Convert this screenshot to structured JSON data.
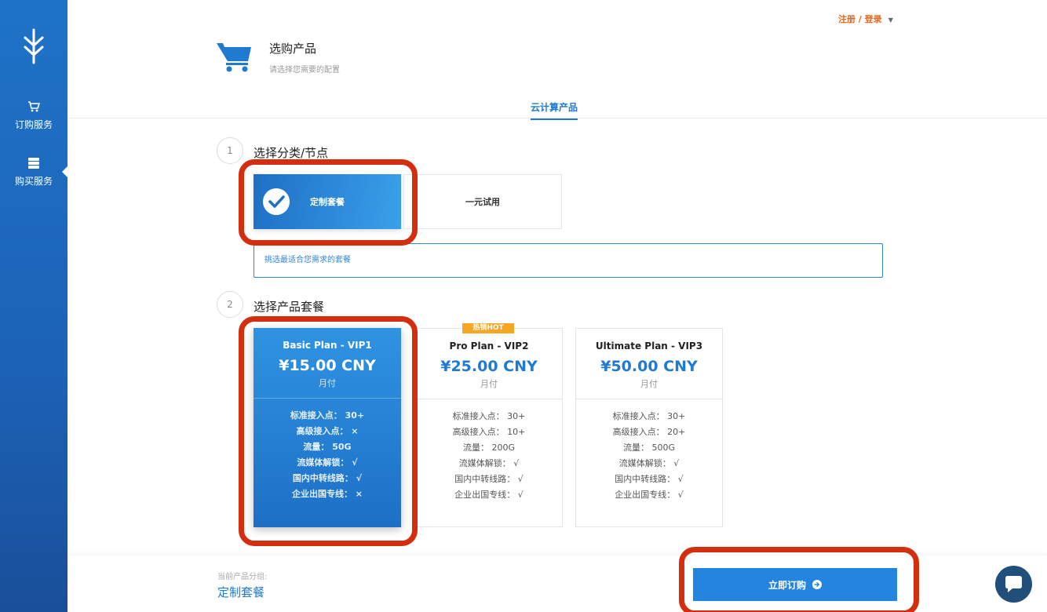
{
  "sidebar": {
    "items": [
      {
        "label": "订购服务",
        "icon": "cart-icon"
      },
      {
        "label": "购买服务",
        "icon": "list-icon"
      }
    ]
  },
  "header": {
    "login_link": "注册 / 登录",
    "title": "选购产品",
    "subtitle": "请选择您需要的配置",
    "tab": "云计算产品"
  },
  "step1": {
    "number": "1",
    "title": "选择分类/节点",
    "categories": [
      {
        "label": "定制套餐",
        "selected": true
      },
      {
        "label": "一元试用",
        "selected": false
      }
    ],
    "description": "挑选最适合您需求的套餐"
  },
  "step2": {
    "number": "2",
    "title": "选择产品套餐",
    "hot_badge": "热销HOT",
    "plans": [
      {
        "name": "Basic Plan - VIP1",
        "price": "¥15.00 CNY",
        "period": "月付",
        "selected": true,
        "features": [
          "标准接入点：  30+",
          "高级接入点：  ×",
          "流量：  50G",
          "流媒体解锁：  √",
          "国内中转线路：  √",
          "企业出国专线：  ×"
        ]
      },
      {
        "name": "Pro Plan - VIP2",
        "price": "¥25.00 CNY",
        "period": "月付",
        "selected": false,
        "features": [
          "标准接入点：  30+",
          "高级接入点：  10+",
          "流量：  200G",
          "流媒体解锁：  √",
          "国内中转线路：  √",
          "企业出国专线：  √"
        ]
      },
      {
        "name": "Ultimate Plan - VIP3",
        "price": "¥50.00 CNY",
        "period": "月付",
        "selected": false,
        "features": [
          "标准接入点：  30+",
          "高级接入点：  20+",
          "流量：  500G",
          "流媒体解锁：  √",
          "国内中转线路：  √",
          "企业出国专线：  √"
        ]
      }
    ]
  },
  "footer": {
    "current_group_label": "当前产品分组:",
    "current_group_value": "定制套餐",
    "order_button": "立即订购"
  },
  "colors": {
    "primary": "#1f7ad0",
    "accent": "#e8651a",
    "highlight": "#d32f0f",
    "hot": "#f5a623"
  }
}
